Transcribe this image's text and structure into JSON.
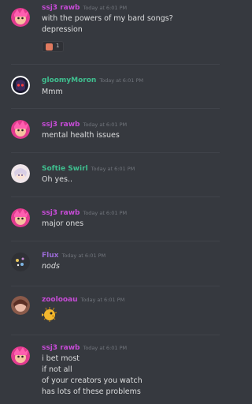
{
  "messages": [
    {
      "author": "ssj3 rawb",
      "author_color": "#c64bd6",
      "timestamp": "Today at 6:01 PM",
      "lines": [
        "with the powers of my bard songs?",
        "depression"
      ],
      "reaction": {
        "emoji": "emoji-icon",
        "count": "1"
      }
    },
    {
      "author": "gloomyMoron",
      "author_color": "#3fbf8f",
      "timestamp": "Today at 6:01 PM",
      "lines": [
        "Mmm"
      ]
    },
    {
      "author": "ssj3 rawb",
      "author_color": "#c64bd6",
      "timestamp": "Today at 6:01 PM",
      "lines": [
        "mental health issues"
      ]
    },
    {
      "author": "Softie Swirl",
      "author_color": "#3fbf8f",
      "timestamp": "Today at 6:01 PM",
      "lines": [
        "Oh yes.."
      ]
    },
    {
      "author": "ssj3 rawb",
      "author_color": "#c64bd6",
      "timestamp": "Today at 6:01 PM",
      "lines": [
        "major ones"
      ]
    },
    {
      "author": "Flux",
      "author_color": "#9b6bd6",
      "timestamp": "Today at 6:01 PM",
      "lines": [
        "nods"
      ]
    },
    {
      "author": "zoolooau",
      "author_color": "#c64bd6",
      "timestamp": "Today at 6:01 PM",
      "emoji": "pufferfish-emoji"
    },
    {
      "author": "ssj3 rawb",
      "author_color": "#c64bd6",
      "timestamp": "Today at 6:01 PM",
      "lines": [
        "i bet most",
        "if not all",
        "of your creators you watch",
        "has lots of these problems"
      ]
    }
  ]
}
